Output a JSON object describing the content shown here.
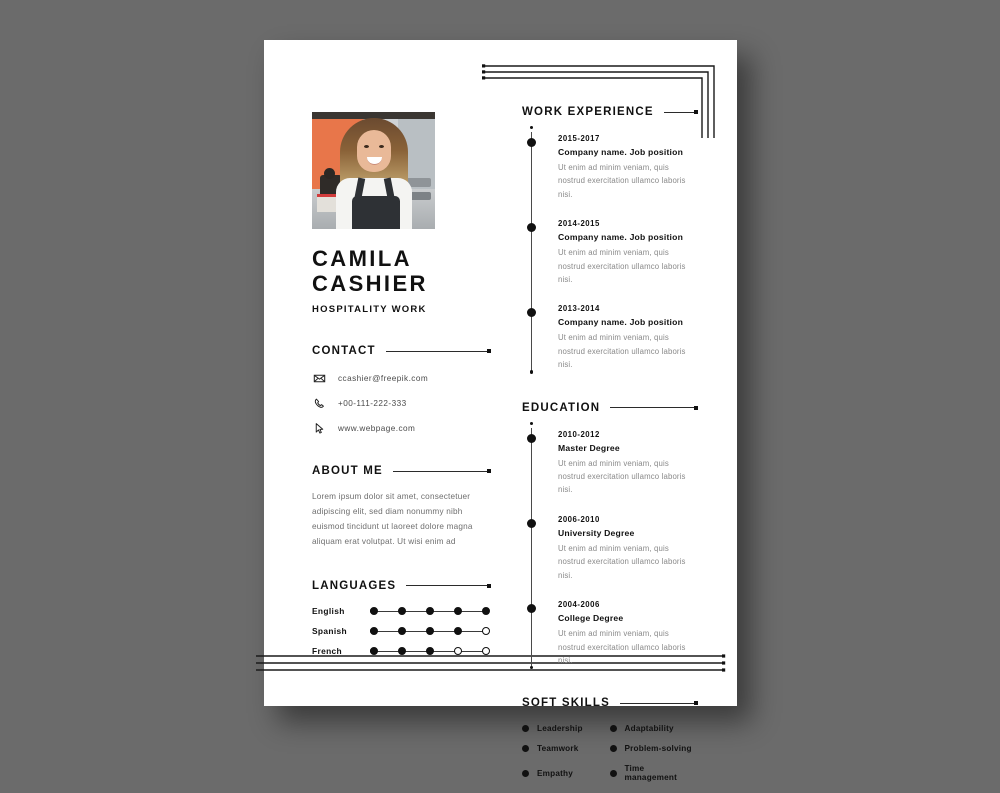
{
  "document": {
    "type": "resume-template",
    "background_color": "#6b6b6b",
    "page_color": "#ffffff"
  },
  "profile": {
    "name_line1": "CAMILA",
    "name_line2": "CASHIER",
    "role": "HOSPITALITY WORK",
    "photo_alt": "Smiling woman with long hair wearing a white shirt and dark apron in a cafe"
  },
  "contact": {
    "title": "CONTACT",
    "items": [
      {
        "icon": "envelope-icon",
        "value": "ccashier@freepik.com"
      },
      {
        "icon": "phone-icon",
        "value": "+00-111-222-333"
      },
      {
        "icon": "cursor-icon",
        "value": "www.webpage.com"
      }
    ]
  },
  "about": {
    "title": "ABOUT ME",
    "text": "Lorem ipsum dolor sit amet, consectetuer adipiscing elit, sed diam nonummy nibh euismod tincidunt ut laoreet dolore magna aliquam erat volutpat. Ut wisi enim ad"
  },
  "languages": {
    "title": "LANGUAGES",
    "max_level": 5,
    "items": [
      {
        "name": "English",
        "level": 5
      },
      {
        "name": "Spanish",
        "level": 4
      },
      {
        "name": "French",
        "level": 3
      }
    ]
  },
  "work_experience": {
    "title": "WORK EXPERIENCE",
    "items": [
      {
        "date": "2015-2017",
        "heading": "Company name. Job position",
        "description": "Ut enim ad minim veniam, quis nostrud exercitation ullamco laboris nisi."
      },
      {
        "date": "2014-2015",
        "heading": "Company name. Job position",
        "description": "Ut enim ad minim veniam, quis nostrud exercitation ullamco laboris nisi."
      },
      {
        "date": "2013-2014",
        "heading": "Company name. Job position",
        "description": "Ut enim ad minim veniam, quis nostrud exercitation ullamco laboris nisi."
      }
    ]
  },
  "education": {
    "title": "EDUCATION",
    "items": [
      {
        "date": "2010-2012",
        "heading": "Master Degree",
        "description": "Ut enim ad minim veniam, quis nostrud exercitation ullamco laboris nisi."
      },
      {
        "date": "2006-2010",
        "heading": "University Degree",
        "description": "Ut enim ad minim veniam, quis nostrud exercitation ullamco laboris nisi."
      },
      {
        "date": "2004-2006",
        "heading": "College Degree",
        "description": "Ut enim ad minim veniam, quis nostrud exercitation ullamco laboris nisi."
      }
    ]
  },
  "soft_skills": {
    "title": "SOFT SKILLS",
    "items": [
      "Leadership",
      "Adaptability",
      "Teamwork",
      "Problem-solving",
      "Empathy",
      "Time management"
    ]
  }
}
